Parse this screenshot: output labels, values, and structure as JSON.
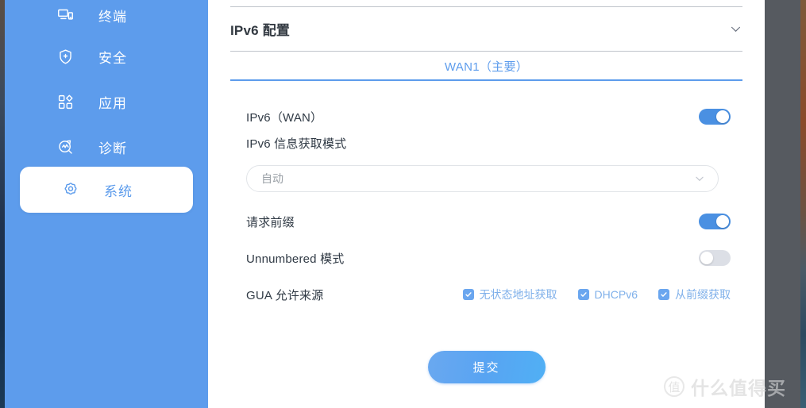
{
  "sidebar": {
    "background_color": "#5d9cec",
    "items": [
      {
        "label": "终端",
        "icon": "devices-icon",
        "active": false
      },
      {
        "label": "安全",
        "icon": "shield-plus-icon",
        "active": false
      },
      {
        "label": "应用",
        "icon": "apps-grid-icon",
        "active": false
      },
      {
        "label": "诊断",
        "icon": "diagnostics-icon",
        "active": false
      },
      {
        "label": "系统",
        "icon": "gear-icon",
        "active": true
      }
    ],
    "collapse_handle": {
      "icon": "chevron-right-icon"
    }
  },
  "panel": {
    "title": "IPv6 配置",
    "collapse_icon": "chevron-down-icon",
    "tab": {
      "label": "WAN1（主要）",
      "active": true,
      "accent_color": "#5d9cec"
    }
  },
  "form": {
    "ipv6_wan": {
      "label": "IPv6（WAN）",
      "toggle": "on"
    },
    "mode": {
      "label": "IPv6 信息获取模式",
      "value": "自动",
      "placeholder": "自动",
      "chevron_icon": "chevron-down-icon"
    },
    "request_prefix": {
      "label": "请求前缀",
      "toggle": "on"
    },
    "unnumbered": {
      "label": "Unnumbered 模式",
      "toggle": "off"
    },
    "gua": {
      "label": "GUA 允许来源",
      "options": [
        {
          "label": "无状态地址获取",
          "checked": true
        },
        {
          "label": "DHCPv6",
          "checked": true
        },
        {
          "label": "从前缀获取",
          "checked": true
        }
      ]
    }
  },
  "actions": {
    "submit_label": "提交"
  },
  "watermark": {
    "badge": "值",
    "text": "什么值得买"
  },
  "colors": {
    "accent": "#5d9cec",
    "toggle_on": "#4a90e2",
    "toggle_off": "#dcdfe6",
    "checkbox": "#6aa6ef",
    "checkbox_label": "#7fb0ea",
    "title_text": "#333a42",
    "right_band": "#565a60"
  }
}
